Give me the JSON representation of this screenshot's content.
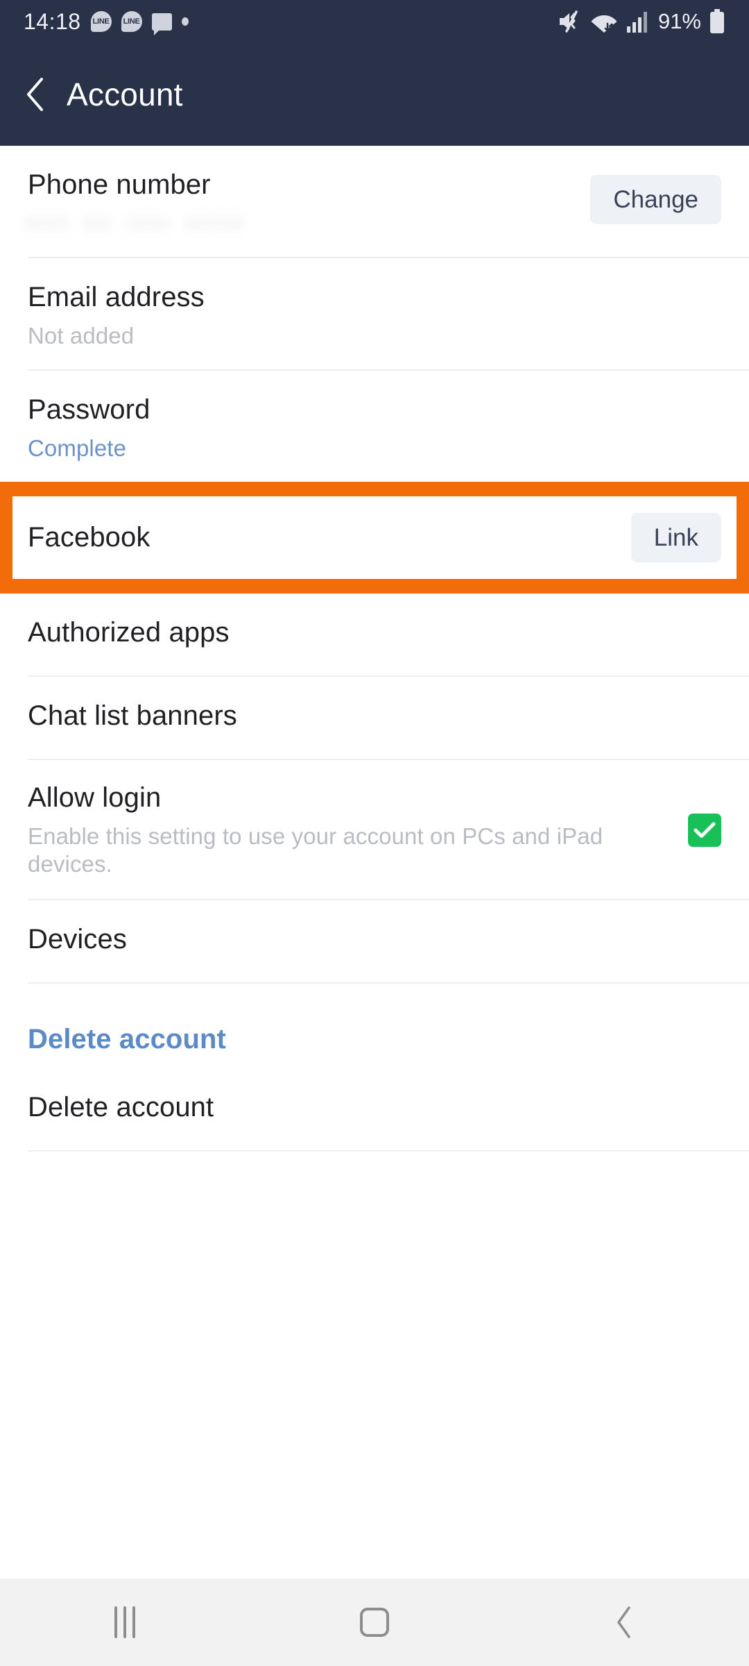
{
  "status_bar": {
    "time": "14:18",
    "notification_icons": [
      "line-icon",
      "line-icon",
      "message-icon",
      "dot-icon"
    ],
    "right_icons": [
      "mute-icon",
      "wifi-icon",
      "signal-icon",
      "battery-icon"
    ],
    "battery_percent": "91%"
  },
  "app_bar": {
    "back_icon": "back-chevron-icon",
    "title": "Account"
  },
  "settings": {
    "rows": [
      {
        "name": "phone-number",
        "title": "Phone number",
        "sub": "••• •• ••• ••••",
        "sub_style": "blurred",
        "button": "Change"
      },
      {
        "name": "email-address",
        "title": "Email address",
        "sub": "Not added",
        "sub_style": "muted",
        "button": null
      },
      {
        "name": "password",
        "title": "Password",
        "sub": "Complete",
        "sub_style": "link",
        "button": null
      },
      {
        "name": "facebook",
        "title": "Facebook",
        "sub": null,
        "sub_style": null,
        "button": "Link",
        "highlighted": true
      },
      {
        "name": "authorized-apps",
        "title": "Authorized apps",
        "sub": null,
        "sub_style": null,
        "button": null
      },
      {
        "name": "chat-list-banners",
        "title": "Chat list banners",
        "sub": null,
        "sub_style": null,
        "button": null
      },
      {
        "name": "allow-login",
        "title": "Allow login",
        "sub": "Enable this setting to use your account on PCs and iPad devices.",
        "sub_style": "muted",
        "checkbox": true,
        "checked": true
      },
      {
        "name": "devices",
        "title": "Devices",
        "sub": null,
        "sub_style": null,
        "button": null
      }
    ],
    "delete_account_link": "Delete account",
    "delete_account_row": "Delete account"
  },
  "highlight": {
    "color": "#f26c0a"
  },
  "colors": {
    "header_bg": "#2a3249",
    "accent_link": "#6b93c9",
    "checkbox_green": "#17c157",
    "button_bg": "#eef1f6",
    "highlight_orange": "#f26c0a"
  },
  "nav_bar": {
    "recents_label": "recents-icon",
    "home_label": "home-icon",
    "back_label": "back-icon"
  }
}
